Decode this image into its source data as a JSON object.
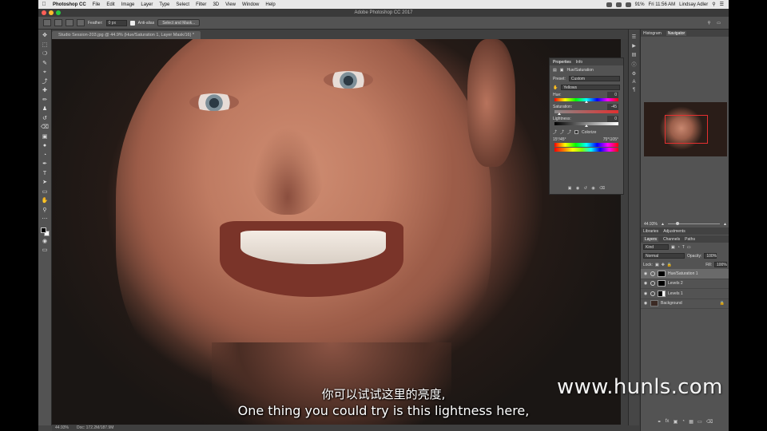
{
  "menubar": {
    "app_name": "Photoshop CC",
    "items": [
      "File",
      "Edit",
      "Image",
      "Layer",
      "Type",
      "Select",
      "Filter",
      "3D",
      "View",
      "Window",
      "Help"
    ],
    "battery": "91%",
    "clock": "Fri 11:56 AM",
    "user": "Lindsay Adler"
  },
  "window": {
    "title": "Adobe Photoshop CC 2017"
  },
  "options_bar": {
    "feather_label": "Feather:",
    "feather_value": "0 px",
    "antialias_label": "Anti-alias",
    "select_mask_button": "Select and Mask..."
  },
  "document": {
    "tab_title": "Studio Session-203.jpg @ 44.9% (Hue/Saturation 1, Layer Mask/16) *",
    "zoom": "44.93%",
    "doc_size": "Doc: 172.2M/187.9M"
  },
  "properties": {
    "tabs": [
      "Properties",
      "Info"
    ],
    "adjustment_name": "Hue/Saturation",
    "preset_label": "Preset:",
    "preset_value": "Custom",
    "channel_value": "Yellows",
    "hue_label": "Hue:",
    "hue_value": "0",
    "saturation_label": "Saturation:",
    "saturation_value": "-45",
    "lightness_label": "Lightness:",
    "lightness_value": "0",
    "colorize_label": "Colorize",
    "range_left": "15°/45°",
    "range_right": "75°\\105°"
  },
  "dock": {
    "top_tabs": [
      "Histogram",
      "Navigator"
    ],
    "nav_zoom": "44.93%",
    "mid_tabs": [
      "Libraries",
      "Adjustments"
    ],
    "layer_tabs": [
      "Layers",
      "Channels",
      "Paths"
    ],
    "kind_filter": "Kind",
    "blend_mode": "Normal",
    "opacity_label": "Opacity:",
    "opacity_value": "100%",
    "lock_label": "Lock:",
    "fill_label": "Fill:",
    "fill_value": "100%",
    "layers": [
      {
        "name": "Hue/Saturation 1",
        "type": "adjustment",
        "selected": true
      },
      {
        "name": "Levels 2",
        "type": "adjustment",
        "selected": false
      },
      {
        "name": "Levels 1",
        "type": "adjustment",
        "selected": false
      },
      {
        "name": "Background",
        "type": "pixel",
        "selected": false
      }
    ]
  },
  "subtitles": {
    "chinese": "你可以试试这里的亮度,",
    "english": "One thing you could try is this lightness here,"
  },
  "watermark": "www.hunls.com"
}
